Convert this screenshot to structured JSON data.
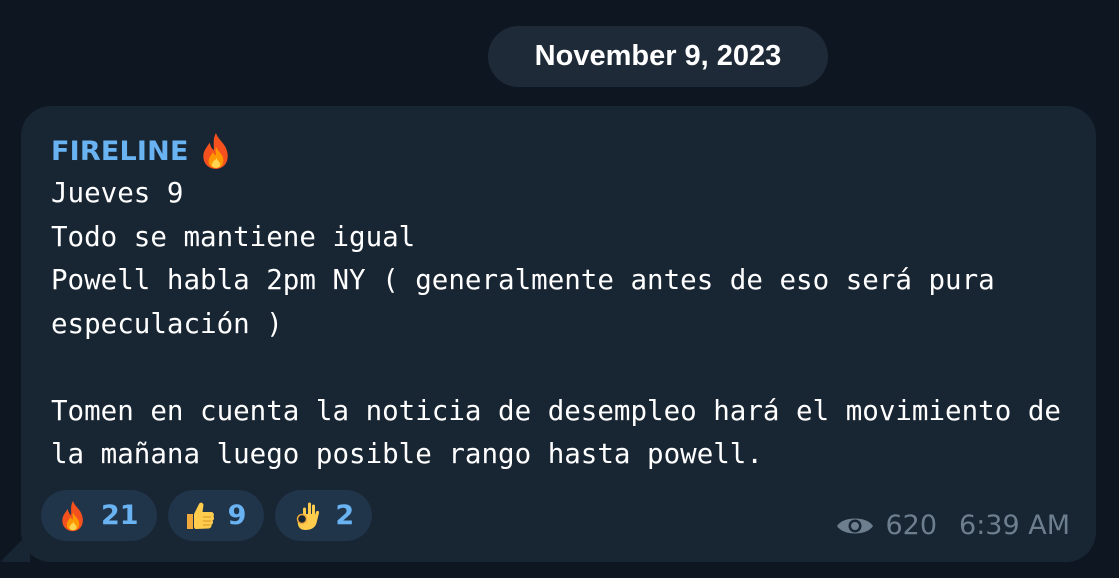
{
  "date_separator": "November 9, 2023",
  "message": {
    "sender": "FIRELINE",
    "sender_emoji": "fire-icon",
    "text": "Jueves 9\nTodo se mantiene igual\nPowell habla 2pm NY ( generalmente antes de eso será pura especulación )\n\nTomen en cuenta la noticia de desempleo hará el movimiento de la mañana luego posible rango hasta powell.",
    "views": "620",
    "time": "6:39 AM"
  },
  "reactions": [
    {
      "icon": "fire-icon",
      "count": "21"
    },
    {
      "icon": "thumbs-up-icon",
      "count": "9"
    },
    {
      "icon": "ok-hand-icon",
      "count": "2"
    }
  ],
  "colors": {
    "background": "#0e1621",
    "bubble": "#182533",
    "accent": "#6ab3f3",
    "meta": "#6d7f8f",
    "reaction_bg": "#20344a"
  }
}
